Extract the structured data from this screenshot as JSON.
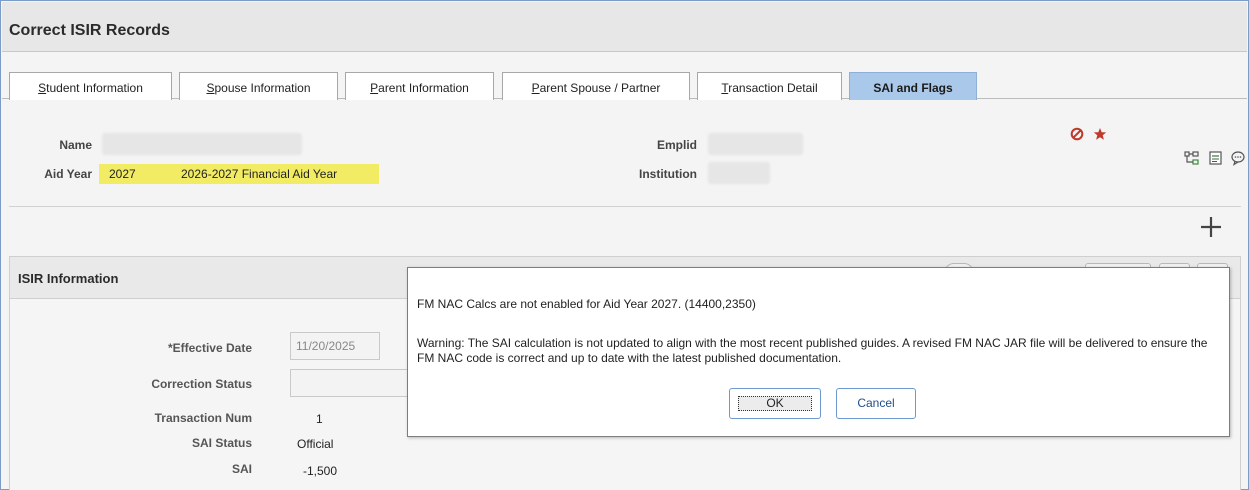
{
  "page_title": "Correct ISIR Records",
  "tabs": [
    {
      "prefix": "",
      "accel": "S",
      "rest": "tudent Information",
      "active": false
    },
    {
      "prefix": "",
      "accel": "S",
      "rest": "pouse Information",
      "active": false
    },
    {
      "prefix": "",
      "accel": "P",
      "rest": "arent Information",
      "active": false
    },
    {
      "prefix": "",
      "accel": "P",
      "rest": "arent Spouse / Partner",
      "active": false
    },
    {
      "prefix": "",
      "accel": "T",
      "rest": "ransaction Detail",
      "active": false
    },
    {
      "prefix": "",
      "accel": "",
      "rest": "SAI and Flags",
      "active": true
    }
  ],
  "header": {
    "name_label": "Name",
    "aid_year_label": "Aid Year",
    "aid_year_value": "2027",
    "aid_year_desc": "2026-2027 Financial Aid Year",
    "emplid_label": "Emplid",
    "institution_label": "Institution"
  },
  "icons": {
    "prohibited": "prohibited-icon",
    "star": "star-icon",
    "org_chart": "related-content-icon",
    "notepad": "notepad-icon",
    "comment": "comment-icon",
    "add": "add-icon"
  },
  "colors": {
    "highlight": "#f2ec64",
    "active_tab": "#a9c8ea",
    "red_icon": "#c0392b"
  },
  "isir": {
    "section_title": "ISIR Information",
    "effective_date_label": "*Effective Date",
    "effective_date_value": "11/20/2025",
    "correction_status_label": "Correction Status",
    "correction_status_value": "",
    "transaction_num_label": "Transaction Num",
    "transaction_num_value": "1",
    "sai_status_label": "SAI Status",
    "sai_status_value": "Official",
    "sai_label": "SAI",
    "sai_value": "-1,500"
  },
  "modal": {
    "message1": "FM NAC Calcs are not enabled for Aid Year 2027. (14400,2350)",
    "message2": "Warning: The SAI calculation is not updated to align with the most recent published guides. A revised FM NAC JAR file will be delivered to ensure the FM NAC code is correct and up to date with the latest published documentation.",
    "ok_label": "OK",
    "cancel_label": "Cancel"
  }
}
